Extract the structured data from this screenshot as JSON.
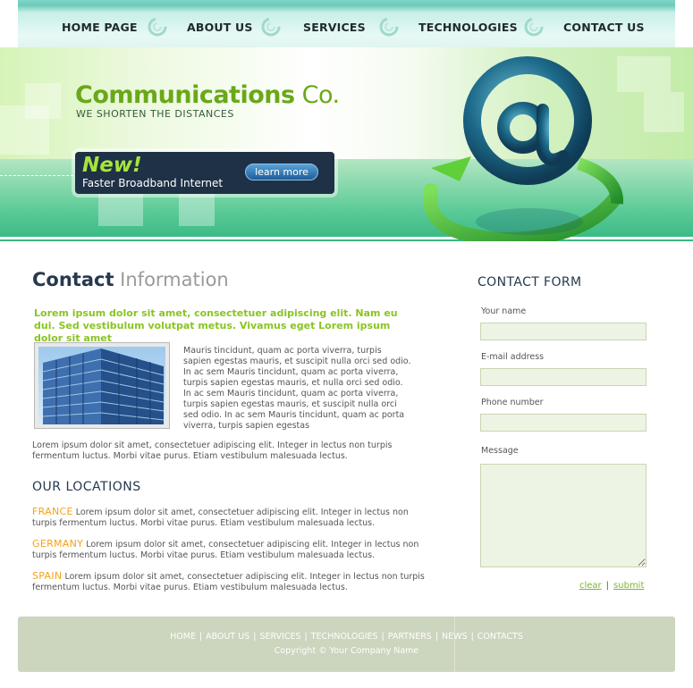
{
  "nav": {
    "items": [
      {
        "label": "HOME PAGE"
      },
      {
        "label": "ABOUT US"
      },
      {
        "label": "SERVICES"
      },
      {
        "label": "TECHNOLOGIES"
      },
      {
        "label": "CONTACT US"
      }
    ]
  },
  "banner": {
    "brand_main": "Communications",
    "brand_co": " Co.",
    "tagline": "WE SHORTEN THE DISTANCES",
    "promo_new": "New!",
    "promo_text": "Faster Broadband Internet",
    "promo_button": "learn more"
  },
  "main": {
    "title_strong": "Contact",
    "title_light": " Information",
    "lead": "Lorem ipsum dolor sit amet, consectetuer adipiscing elit. Nam eu dui. Sed vestibulum volutpat metus. Vivamus eget Lorem ipsum dolor sit amet",
    "side_text": "Mauris tincidunt, quam ac porta viverra, turpis sapien egestas mauris, et suscipit nulla orci sed odio. In ac sem Mauris tincidunt, quam ac porta viverra, turpis sapien egestas mauris, et nulla orci sed odio. In ac sem  Mauris tincidunt, quam ac porta viverra, turpis sapien egestas mauris, et suscipit nulla orci sed odio. In ac sem Mauris tincidunt, quam ac porta viverra, turpis sapien egestas",
    "para": "Lorem ipsum dolor sit amet, consectetuer adipiscing elit. Integer in lectus non turpis fermentum luctus. Morbi vitae purus. Etiam vestibulum malesuada lectus.",
    "locations_title": "OUR LOCATIONS",
    "locations": [
      {
        "country": "FRANCE",
        "text": " Lorem ipsum dolor sit amet, consectetuer adipiscing elit. Integer in lectus non turpis fermentum luctus. Morbi vitae purus. Etiam vestibulum malesuada lectus."
      },
      {
        "country": "GERMANY",
        "text": " Lorem ipsum dolor sit amet, consectetuer adipiscing elit. Integer in lectus non turpis fermentum luctus. Morbi vitae purus. Etiam vestibulum malesuada lectus."
      },
      {
        "country": "SPAIN",
        "text": " Lorem ipsum dolor sit amet, consectetuer adipiscing elit. Integer in lectus non turpis fermentum luctus. Morbi vitae purus. Etiam vestibulum malesuada lectus."
      }
    ]
  },
  "form": {
    "title": "CONTACT FORM",
    "name_label": "Your name",
    "email_label": "E-mail address",
    "phone_label": "Phone number",
    "message_label": "Message",
    "name_value": "",
    "email_value": "",
    "phone_value": "",
    "message_value": "",
    "clear": "clear",
    "separator": "|",
    "submit": "submit"
  },
  "footer": {
    "links": [
      "HOME",
      "ABOUT US",
      "SERVICES",
      "TECHNOLOGIES",
      "PARTNERS",
      "NEWS",
      "CONTACTS"
    ],
    "separator": "|",
    "copyright": "Copyright © Your Company Name"
  },
  "colors": {
    "accent_green": "#8ac422",
    "brand_green": "#6aa818",
    "heading_navy": "#26394f",
    "country_orange": "#f3a31b",
    "footer_bg": "#ccd5be"
  },
  "icons": [
    "swirl-icon",
    "at-sign-icon",
    "building-photo"
  ]
}
